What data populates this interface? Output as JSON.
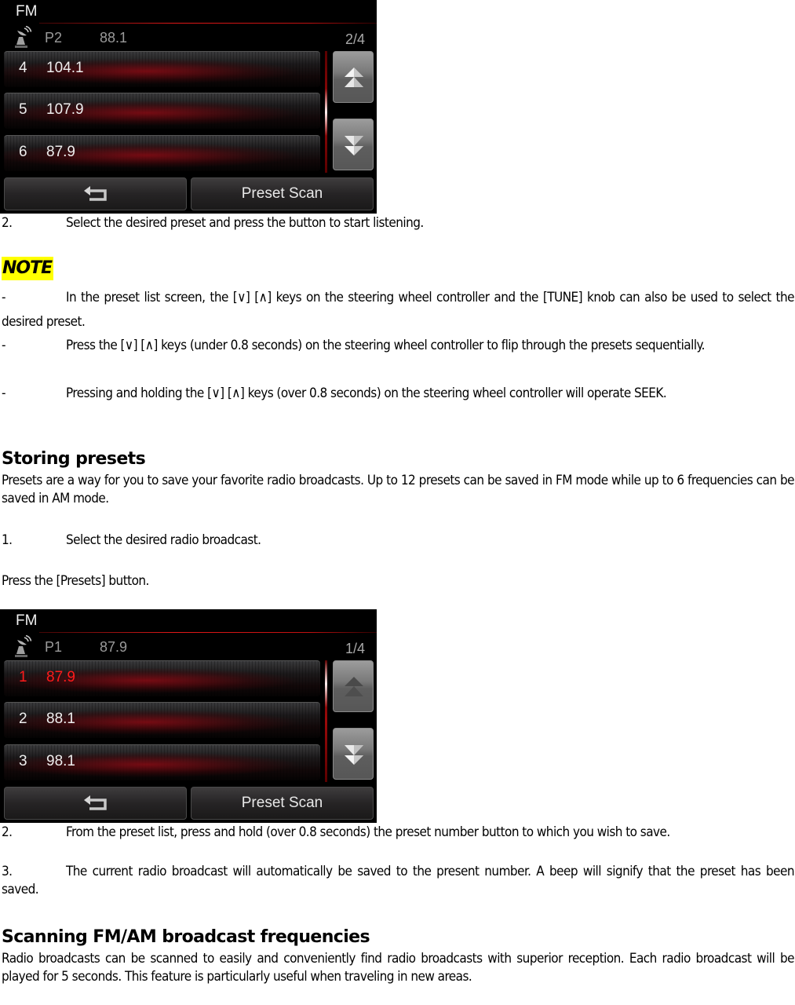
{
  "screens": [
    {
      "band": "FM",
      "current_preset": "P2",
      "current_frequency": "88.1",
      "page_indicator": "2/4",
      "scroll_position": 0.5,
      "presets": [
        {
          "number": "4",
          "frequency": "104.1",
          "active": false
        },
        {
          "number": "5",
          "frequency": "107.9",
          "active": false
        },
        {
          "number": "6",
          "frequency": "87.9",
          "active": false
        }
      ],
      "up_enabled": true,
      "down_enabled": true,
      "back_icon": "back-arrow-icon",
      "preset_scan_label": "Preset Scan"
    },
    {
      "band": "FM",
      "current_preset": "P1",
      "current_frequency": "87.9",
      "page_indicator": "1/4",
      "scroll_position": 0.0,
      "presets": [
        {
          "number": "1",
          "frequency": "87.9",
          "active": true
        },
        {
          "number": "2",
          "frequency": "88.1",
          "active": false
        },
        {
          "number": "3",
          "frequency": "98.1",
          "active": false
        }
      ],
      "up_enabled": false,
      "down_enabled": true,
      "back_icon": "back-arrow-icon",
      "preset_scan_label": "Preset Scan"
    }
  ],
  "colors": {
    "active_preset": "#ff1a1a",
    "accent_line": "#e01818",
    "note_highlight": "#ffff00"
  },
  "doc": {
    "step2_select": {
      "marker": "2.",
      "text": "Select the desired preset and press the button to start listening."
    },
    "note_label": "NOTE",
    "note_items": [
      {
        "marker": "-",
        "text": "In the preset list screen, the [∨] [∧] keys on the steering wheel controller and the [TUNE] knob can also be used to select the desired preset."
      },
      {
        "marker": "-",
        "text": "Press the [∨] [∧] keys (under 0.8 seconds) on the steering wheel controller to flip through the presets sequentially."
      },
      {
        "marker": "-",
        "text": "Pressing and holding the [∨] [∧] keys (over 0.8 seconds) on the steering wheel controller will operate SEEK."
      }
    ],
    "storing_heading": "Storing presets",
    "storing_intro": "Presets are a way for you to save your favorite radio broadcasts. Up to 12 presets can be saved in FM mode while up to 6 frequencies can be saved in AM mode.",
    "storing_step1": {
      "marker": "1.",
      "text": "Select the desired radio broadcast."
    },
    "storing_press": "Press the [Presets] button.",
    "storing_step2": {
      "marker": "2.",
      "text": "From the preset list, press and hold (over 0.8 seconds) the preset number button to which you wish to save."
    },
    "storing_step3": {
      "marker": "3.",
      "text": "The current radio broadcast will automatically be saved to the present number. A beep will signify that the preset has been saved."
    },
    "scanning_heading": "Scanning FM/AM broadcast frequencies",
    "scanning_text": "Radio broadcasts can be scanned to easily and conveniently find radio broadcasts with superior reception. Each radio broadcast will be played for 5 seconds. This feature is particularly useful when traveling in new areas."
  }
}
